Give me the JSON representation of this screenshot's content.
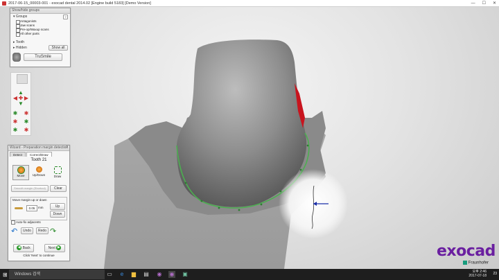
{
  "window": {
    "title": "2017-06-15_00003-001 - exocad dental 2014.02 [Engine build 5183] [Demo Version]",
    "minimize": "—",
    "maximize": "☐",
    "close": "✕"
  },
  "groups_panel": {
    "header": "Show/hide groups",
    "groups_label": "Groups",
    "items": [
      "Antagonists",
      "Jaw scans",
      "Pre-op/Waxup scans",
      "All other parts"
    ],
    "tooth_label": "Tooth",
    "hidden_label": "Hidden",
    "show_all": "Show all",
    "help": "?"
  },
  "trusmile": {
    "label": "TruSmile"
  },
  "wizard": {
    "header": "Wizard - Preparation margin detection",
    "help": "?",
    "tabs": [
      "Detect",
      "Correct/Draw"
    ],
    "tooth_title": "Tooth 21",
    "modes": [
      "Move",
      "Up/Down",
      "Draw"
    ],
    "smooth_button": "Smooth margin (Shortcut)",
    "clear_button": "Clear",
    "move_section": "Move margin up or down",
    "margin_value": "0.05",
    "unit": "mm",
    "up": "Up",
    "down": "Down",
    "auto_fix": "Auto-fix adjacents",
    "undo": "Undo",
    "redo": "Redo",
    "back": "Back",
    "next": "Next",
    "footer": "Click 'Next' to continue"
  },
  "logo": {
    "word": "exocad",
    "fraunhofer": "Fraunhofer"
  },
  "taskbar": {
    "search_placeholder": "Windows 검색",
    "time": "오후 2:46",
    "date": "2017-07-18",
    "notifications": "23"
  },
  "colors": {
    "margin_line": "#4caf50",
    "accent": "#6a1fa0",
    "marker": "#1a2ea8"
  }
}
